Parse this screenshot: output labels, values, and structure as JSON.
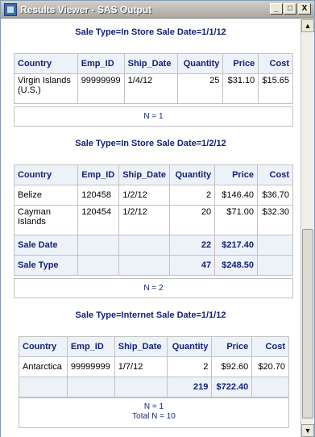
{
  "window": {
    "title": "Results Viewer - SAS Output",
    "buttons": {
      "minimize": "_",
      "maximize": "□",
      "close": "X"
    }
  },
  "sections": [
    {
      "title": "Sale Type=In Store Sale Date=1/1/12",
      "headers": [
        "Country",
        "Emp_ID",
        "Ship_Date",
        "Quantity",
        "Price",
        "Cost"
      ],
      "rows": [
        [
          "Virgin Islands (U.S.)",
          "99999999",
          "1/4/12",
          "25",
          "$31.10",
          "$15.65"
        ]
      ],
      "n_text": "N = 1"
    },
    {
      "title": "Sale Type=In Store Sale Date=1/2/12",
      "headers": [
        "Country",
        "Emp_ID",
        "Ship_Date",
        "Quantity",
        "Price",
        "Cost"
      ],
      "rows": [
        [
          "Belize",
          "120458",
          "1/2/12",
          "2",
          "$146.40",
          "$36.70"
        ],
        [
          "Cayman Islands",
          "120454",
          "1/2/12",
          "20",
          "$71.00",
          "$32.30"
        ]
      ],
      "summaries": [
        {
          "label": "Sale Date",
          "quantity": "22",
          "price": "$217.40"
        },
        {
          "label": "Sale Type",
          "quantity": "47",
          "price": "$248.50"
        }
      ],
      "n_text": "N = 2"
    },
    {
      "title": "Sale Type=Internet Sale Date=1/1/12",
      "headers": [
        "Country",
        "Emp_ID",
        "Ship_Date",
        "Quantity",
        "Price",
        "Cost"
      ],
      "rows": [
        [
          "Antarctica",
          "99999999",
          "1/7/12",
          "2",
          "$92.60",
          "$20.70"
        ]
      ],
      "summaries": [
        {
          "label": "",
          "quantity": "219",
          "price": "$722.40"
        }
      ],
      "n_text": "N = 1",
      "total_text": "Total N = 10"
    }
  ],
  "scrollbar": {
    "up_arrow": "▲",
    "down_arrow": "▼"
  }
}
